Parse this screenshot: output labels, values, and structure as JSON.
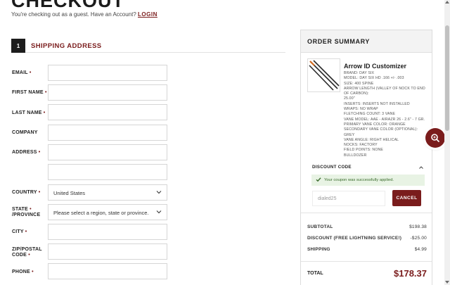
{
  "page": {
    "title": "CHECKOUT",
    "guest_text": "You're checking out as a guest. Have an Account?",
    "login_link": "LOGIN"
  },
  "step": {
    "number": "1",
    "label": "SHIPPING ADDRESS"
  },
  "form": {
    "required_marker": "•",
    "fields": {
      "email": {
        "label": "EMAIL",
        "value": ""
      },
      "first_name": {
        "label": "FIRST NAME",
        "value": ""
      },
      "last_name": {
        "label": "LAST NAME",
        "value": ""
      },
      "company": {
        "label": "COMPANY",
        "value": ""
      },
      "address": {
        "label": "ADDRESS",
        "value": ""
      },
      "address2": {
        "label": "",
        "value": ""
      },
      "country": {
        "label": "COUNTRY",
        "selected": "United States"
      },
      "state": {
        "label_line1": "STATE",
        "label_line2": "/PROVINCE",
        "selected": "Please select a region, state or province."
      },
      "city": {
        "label": "CITY",
        "value": ""
      },
      "zip": {
        "label_line1": "ZIP/POSTAL",
        "label_line2": "CODE",
        "value": ""
      },
      "phone": {
        "label": "PHONE",
        "value": ""
      }
    }
  },
  "summary": {
    "title": "ORDER SUMMARY",
    "item": {
      "name": "Arrow ID Customizer",
      "options": [
        "BRAND: DAY SIX",
        "MODEL: DAY SIX HD .166 +/- .003",
        "SIZE: 400 SPINE",
        "ARROW LENGTH (VALLEY OF NOCK TO END OF CARBON):",
        "25.00\"",
        "INSERTS: INSERTS NOT INSTALLED",
        "WRAPS: NO WRAP",
        "FLETCHING COUNT: 3 VANE",
        "VANE MODEL: AAE - AIRAZR 26 - 2.6\" - 7 GR.",
        "PRIMARY VANE COLOR: ORANGE",
        "SECONDARY VANE COLOR (OPTIONAL): GREY",
        "VANE ANGLE: RIGHT HELICAL",
        "NOCKS: FACTORY",
        "FIELD POINTS: NONE",
        "BULLDOZER"
      ]
    },
    "discount": {
      "toggle_label": "DISCOUNT CODE",
      "success_message": "Your coupon was successfully applied.",
      "code_value": "dialed25",
      "cancel_label": "CANCEL"
    },
    "totals": {
      "subtotal_label": "SUBTOTAL",
      "subtotal_value": "$198.38",
      "discount_label": "DISCOUNT (FREE LIGHTNING SERVICE!)",
      "discount_value": "-$25.00",
      "shipping_label": "SHIPPING",
      "shipping_value": "$4.99",
      "total_label": "TOTAL",
      "total_value": "$178.37"
    }
  },
  "colors": {
    "accent": "#7a1c1c",
    "success_bg": "#e8f3e4",
    "success_text": "#3a6b2c"
  },
  "icons": {
    "fab": "search-icon",
    "select": "chevron-down-icon",
    "toggle": "chevron-up-icon",
    "success": "check-icon"
  }
}
